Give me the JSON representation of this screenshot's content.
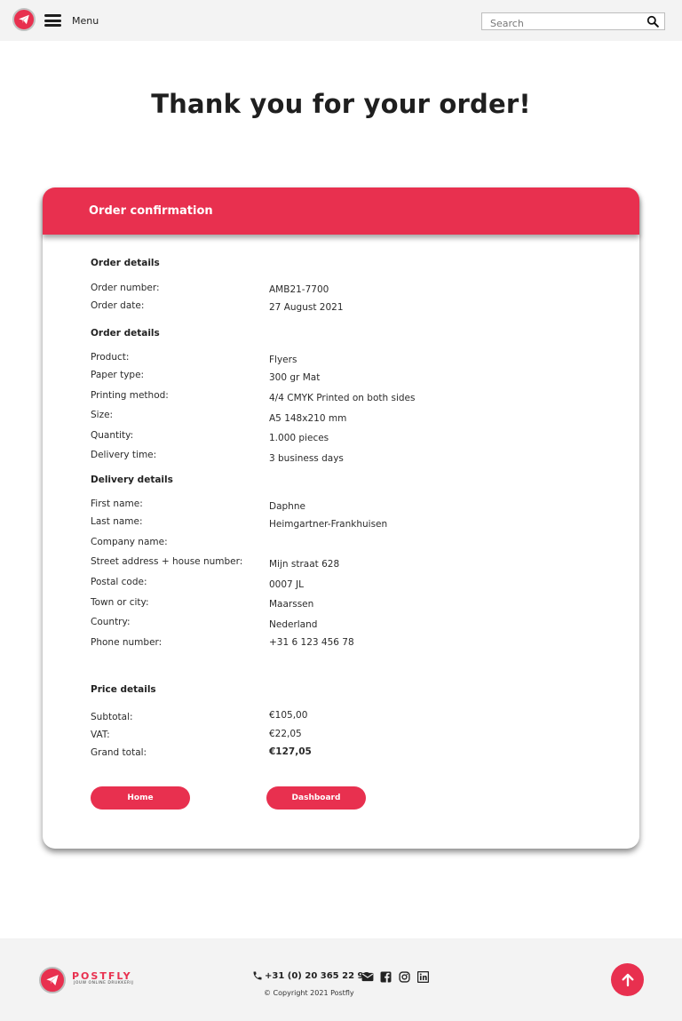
{
  "nav": {
    "menu_label": "Menu",
    "search_placeholder": "Search"
  },
  "page_title": "Thank you for your order!",
  "card": {
    "title": "Order confirmation",
    "order_section_title": "Order details",
    "order": [
      {
        "label": "Order number:",
        "value": "AMB21-7700"
      },
      {
        "label": "Order date:",
        "value": "27 August 2021"
      }
    ],
    "product_section_title": "Order details",
    "product": [
      {
        "label": "Product:",
        "value": "Flyers"
      },
      {
        "label": "Paper type:",
        "value": "300 gr Mat"
      },
      {
        "label": "Printing method:",
        "value": "4/4 CMYK Printed on both sides"
      },
      {
        "label": "Size:",
        "value": "A5 148x210 mm"
      },
      {
        "label": "Quantity:",
        "value": "1.000 pieces"
      },
      {
        "label": "Delivery time:",
        "value": "3 business days"
      }
    ],
    "delivery_section_title": "Delivery details",
    "delivery": [
      {
        "label": "First name:",
        "value": "Daphne"
      },
      {
        "label": "Last name:",
        "value": "Heimgartner-Frankhuisen"
      },
      {
        "label": "Company name:",
        "value": ""
      },
      {
        "label": "Street address + house number:",
        "value": "Mijn straat 628"
      },
      {
        "label": "Postal code:",
        "value": "0007 JL"
      },
      {
        "label": "Town or city:",
        "value": "Maarssen"
      },
      {
        "label": "Country:",
        "value": "Nederland"
      },
      {
        "label": "Phone number:",
        "value": "+31 6 123 456 78"
      }
    ],
    "price_section_title": "Price details",
    "price": [
      {
        "label": "Subtotal:",
        "value": "€105,00"
      },
      {
        "label": "VAT:",
        "value": "€22,05"
      },
      {
        "label": "Grand total:",
        "value": "€127,05"
      }
    ],
    "home_button": "Home",
    "dashboard_button": "Dashboard"
  },
  "footer": {
    "brand": "POSTFLY",
    "tagline": "JOUW ONLINE DRUKKERIJ",
    "phone": "+31 (0) 20 365 22 93",
    "copyright": "© Copyright 2021 Postfly",
    "social_icons": [
      "envelope-icon",
      "facebook-icon",
      "instagram-icon",
      "linkedin-icon"
    ]
  },
  "colors": {
    "accent": "#e8304f",
    "nav_bg": "#f3f3f3"
  }
}
